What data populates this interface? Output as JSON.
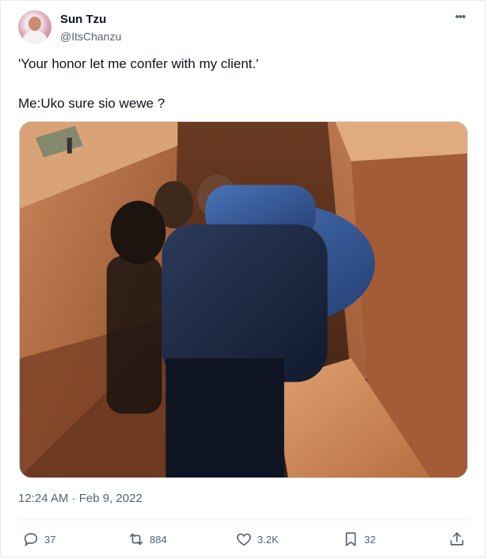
{
  "author": {
    "name": "Sun Tzu",
    "handle": "@ItsChanzu"
  },
  "tweet": {
    "line1": "'Your honor let me confer with my client.'",
    "line2": "Me:Uko sure sio wewe ?",
    "timestamp": "12:24 AM · Feb 9, 2022"
  },
  "actions": {
    "replies": "37",
    "retweets": "884",
    "likes": "3.2K",
    "bookmarks": "32"
  },
  "icons": {
    "more": "more-horizontal-icon",
    "reply": "reply-icon",
    "retweet": "retweet-icon",
    "like": "heart-icon",
    "bookmark": "bookmark-icon",
    "share": "share-icon"
  },
  "colors": {
    "text": "#0f1419",
    "secondary": "#536471",
    "wood": "#b8724a",
    "suit_dark": "#1e2a44",
    "suit_blue": "#3c62a6"
  }
}
